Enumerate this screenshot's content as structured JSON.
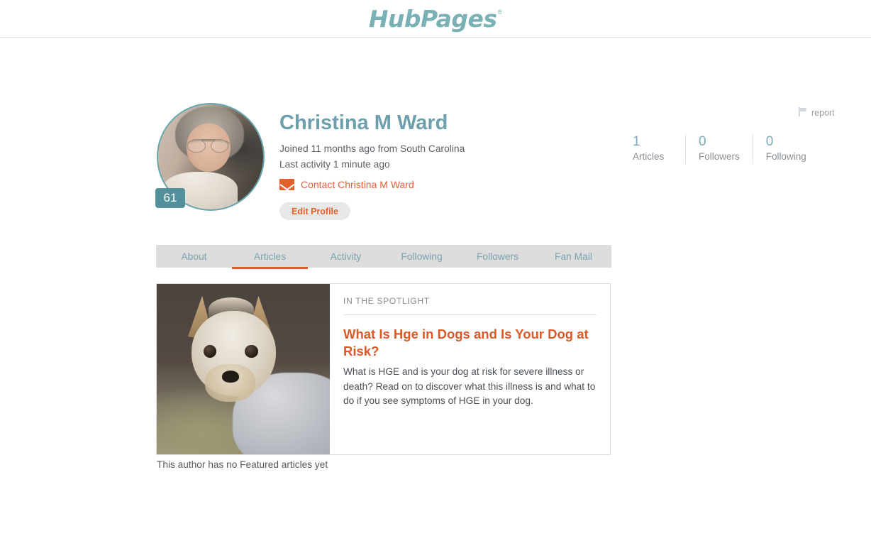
{
  "header": {
    "logo_text": "HubPages",
    "logo_registered": "®",
    "logo_color": "#79b1b7"
  },
  "report": {
    "label": "report",
    "icon": "flag-icon"
  },
  "stats": [
    {
      "value": "1",
      "label": "Articles"
    },
    {
      "value": "0",
      "label": "Followers"
    },
    {
      "value": "0",
      "label": "Following"
    }
  ],
  "profile": {
    "name": "Christina M Ward",
    "name_color": "#6d9fad",
    "joined": "Joined 11 months ago from South Carolina",
    "last_activity": "Last activity 1 minute ago",
    "contact_label": "Contact Christina M Ward",
    "contact_icon": "envelope-icon",
    "edit_label": "Edit Profile",
    "accent_color": "#e3602c",
    "avatar": {
      "badge_value": "61",
      "badge_color": "#52909c",
      "ring_color": "#63a6af"
    }
  },
  "tabs": [
    {
      "label": "About",
      "active": false
    },
    {
      "label": "Articles",
      "active": true
    },
    {
      "label": "Activity",
      "active": false
    },
    {
      "label": "Following",
      "active": false
    },
    {
      "label": "Followers",
      "active": false
    },
    {
      "label": "Fan Mail",
      "active": false
    }
  ],
  "tabs_active_underline_color": "#e0592a",
  "spotlight": {
    "label": "IN THE SPOTLIGHT",
    "title": "What Is Hge in Dogs and Is Your Dog at Risk?",
    "title_color": "#dd5a28",
    "description": "What is HGE and is your dog at risk for severe illness or death? Read on to discover what this illness is and what to do if you see symptoms of HGE in your dog.",
    "image_alt": "yorkshire-terrier-photo"
  },
  "empty_state": {
    "message": "This author has no Featured articles yet"
  }
}
